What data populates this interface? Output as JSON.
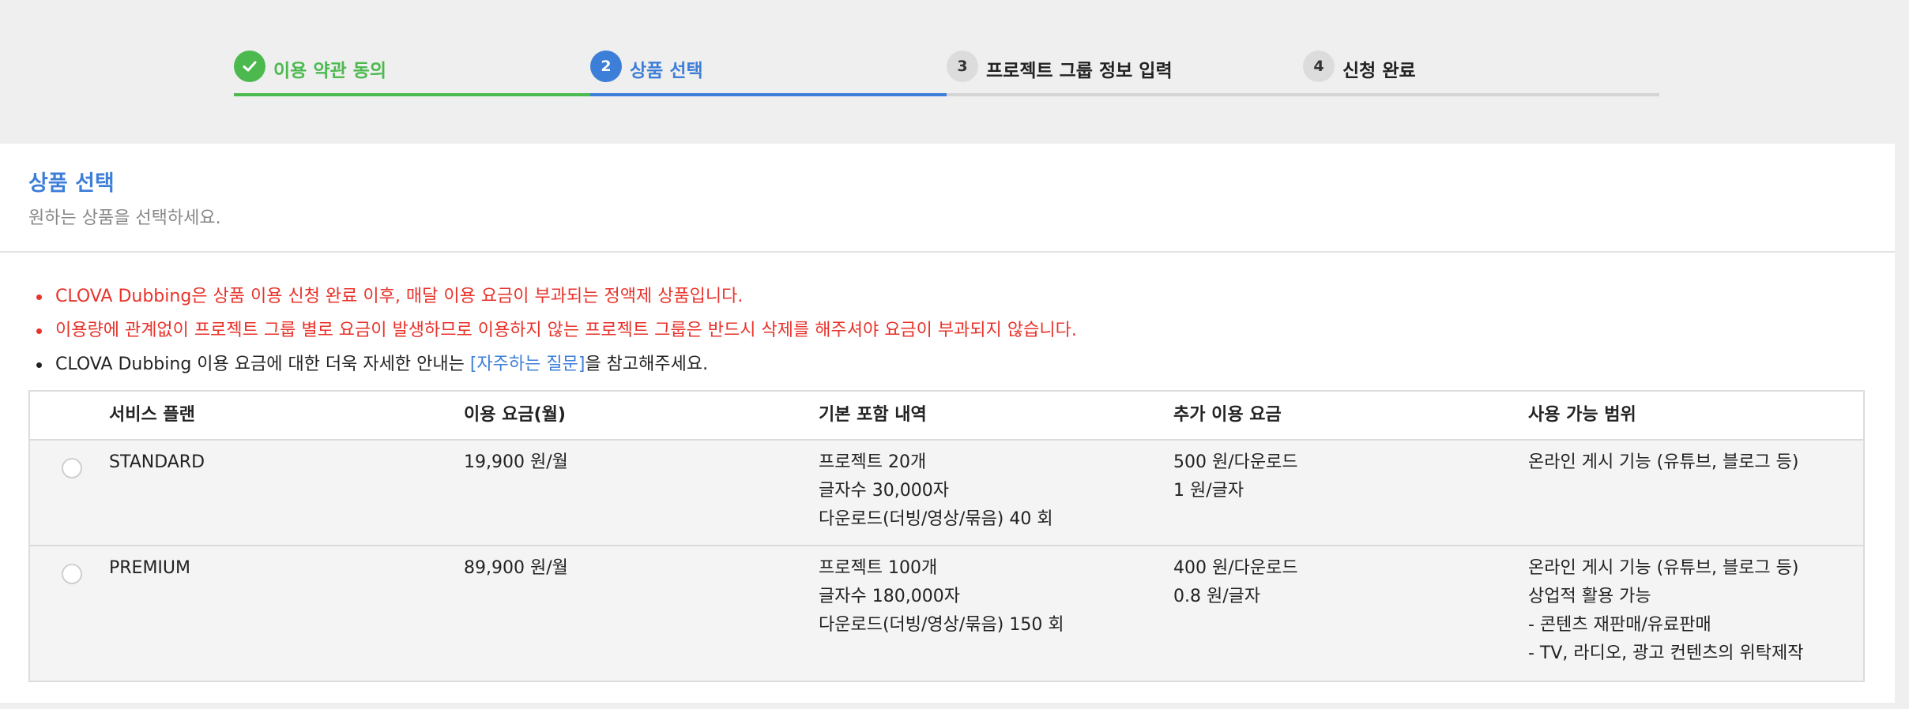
{
  "stepper": {
    "steps": [
      {
        "number": "",
        "label": "이용 약관 동의",
        "state": "done"
      },
      {
        "number": "2",
        "label": "상품 선택",
        "state": "active"
      },
      {
        "number": "3",
        "label": "프로젝트 그룹 정보 입력",
        "state": "todo"
      },
      {
        "number": "4",
        "label": "신청 완료",
        "state": "todo"
      }
    ]
  },
  "section": {
    "title": "상품 선택",
    "subtitle": "원하는 상품을 선택하세요."
  },
  "notes": {
    "line1": "CLOVA Dubbing은 상품 이용 신청 완료 이후, 매달 이용 요금이 부과되는 정액제 상품입니다.",
    "line2": "이용량에 관계없이 프로젝트 그룹 별로 요금이 발생하므로 이용하지 않는 프로젝트 그룹은 반드시 삭제를 해주셔야 요금이 부과되지 않습니다.",
    "line3_prefix": "CLOVA Dubbing 이용 요금에 대한 더욱 자세한 안내는 ",
    "line3_link": "[자주하는 질문]",
    "line3_suffix": "을 참고해주세요."
  },
  "table": {
    "headers": [
      "서비스 플랜",
      "이용 요금(월)",
      "기본 포함 내역",
      "추가 이용 요금",
      "사용 가능 범위"
    ],
    "rows": [
      {
        "plan": "STANDARD",
        "price": "19,900 원/월",
        "included": [
          "프로젝트 20개",
          "글자수 30,000자",
          "다운로드(더빙/영상/묶음) 40 회"
        ],
        "extra": [
          "500 원/다운로드",
          "1 원/글자"
        ],
        "scope": [
          "온라인 게시 기능 (유튜브, 블로그 등)"
        ]
      },
      {
        "plan": "PREMIUM",
        "price": "89,900 원/월",
        "included": [
          "프로젝트 100개",
          "글자수 180,000자",
          "다운로드(더빙/영상/묶음) 150 회"
        ],
        "extra": [
          "400 원/다운로드",
          "0.8 원/글자"
        ],
        "scope": [
          "온라인 게시 기능 (유튜브, 블로그 등)",
          "상업적 활용 가능",
          "- 콘텐츠 재판매/유료판매",
          "- TV, 라디오, 광고 컨텐츠의 위탁제작"
        ]
      }
    ]
  },
  "colors": {
    "done": "#4cb94f",
    "active": "#3d7ed8",
    "warning": "#e8322a"
  },
  "icons": {
    "done_step": "check-icon"
  }
}
